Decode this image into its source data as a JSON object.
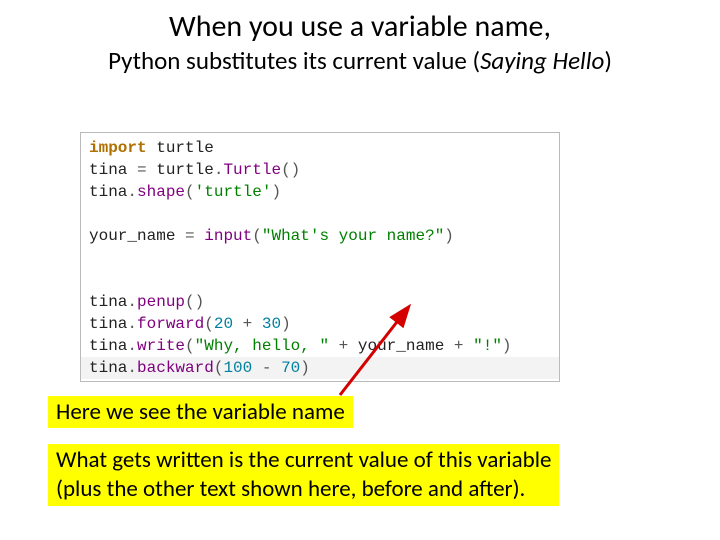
{
  "title_line1": "When you use a variable name,",
  "title_line2_a": "Python substitutes its current value (",
  "title_line2_b": "Saying Hello",
  "title_line2_c": ")",
  "code": {
    "l1_kw": "import",
    "l1_mod": " turtle",
    "l2_a": "tina ",
    "l2_eq": "=",
    "l2_b": " turtle",
    "l2_dot": ".",
    "l2_fn": "Turtle",
    "l2_par": "()",
    "l3_a": "tina",
    "l3_dot": ".",
    "l3_fn": "shape",
    "l3_op": "(",
    "l3_lit": "'turtle'",
    "l3_cp": ")",
    "l5_a": "your_name ",
    "l5_eq": "=",
    "l5_sp": " ",
    "l5_fn": "input",
    "l5_op": "(",
    "l5_lit": "\"What's your name?\"",
    "l5_cp": ")",
    "l8_a": "tina",
    "l8_fn": "penup",
    "l8_par": "()",
    "l9_a": "tina",
    "l9_fn": "forward",
    "l9_op": "(",
    "l9_n1": "20",
    "l9_plus": " + ",
    "l9_n2": "30",
    "l9_cp": ")",
    "l10_a": "tina",
    "l10_fn": "write",
    "l10_op": "(",
    "l10_l1": "\"Why, hello, \"",
    "l10_plus1": " + ",
    "l10_var": "your_name",
    "l10_plus2": " + ",
    "l10_l2": "\"!\"",
    "l10_cp": ")",
    "l11_a": "tina",
    "l11_fn": "backward",
    "l11_op": "(",
    "l11_n1": "100",
    "l11_minus": " - ",
    "l11_n2": "70",
    "l11_cp": ")"
  },
  "callout1": "Here we see the variable name",
  "callout2_l1": "What gets written is the current value of this variable",
  "callout2_l2": "(plus the other text shown here, before and after)."
}
